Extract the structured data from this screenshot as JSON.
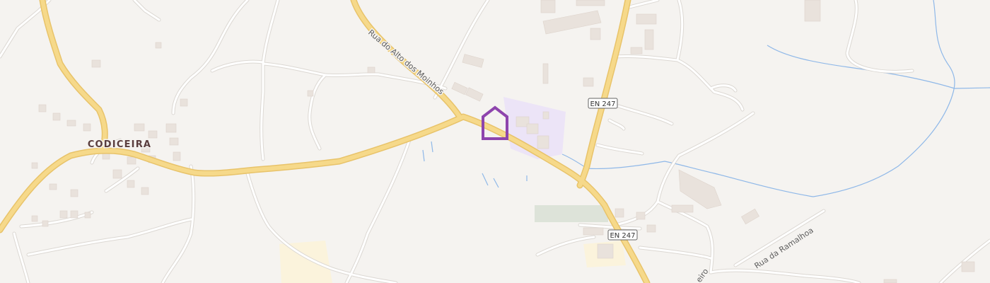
{
  "map": {
    "place": {
      "name": "CODICEIRA"
    },
    "streets": [
      {
        "name": "Rua do Alto dos Moinhos"
      },
      {
        "name": "Rua da Ramalhoa"
      },
      {
        "name": "eiro"
      }
    ],
    "road_shields": [
      {
        "ref": "EN 247"
      },
      {
        "ref": "EN 247"
      }
    ],
    "marker": {
      "icon": "home-marker-icon",
      "color": "#8e44ad"
    },
    "colors": {
      "background": "#f5f3f0",
      "main_road": "#f6d98a",
      "main_road_casing": "#e8c36a",
      "minor_road": "#ffffff",
      "minor_road_casing": "#dcd8d3",
      "building": "#e9e2dc",
      "water": "#8fb8e8",
      "highlight_area": "#ece4f7",
      "field": "#dde3d9",
      "sand": "#fbf3dc"
    }
  }
}
